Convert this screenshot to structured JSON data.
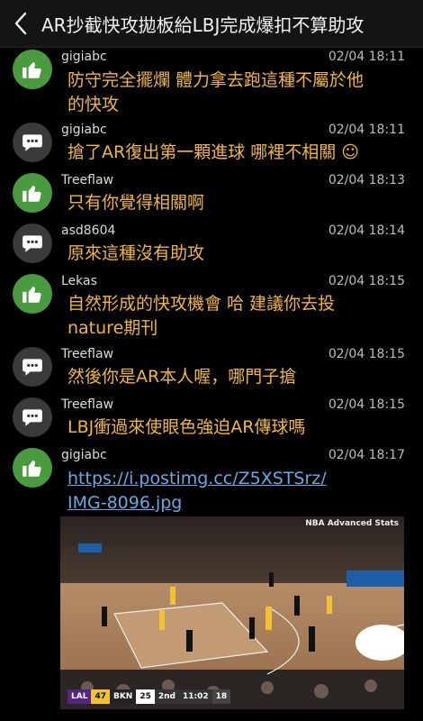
{
  "header": {
    "title": "AR抄截快攻拋板給LBJ完成爆扣不算助攻"
  },
  "posts": [
    {
      "type": "push",
      "user": "gigiabc",
      "time": "02/04 18:11",
      "text": "防守完全擺爛 體力拿去跑這種不屬於他\n的快攻"
    },
    {
      "type": "reply",
      "user": "gigiabc",
      "time": "02/04 18:11",
      "text": "搶了AR復出第一顆進球 哪裡不相關 ☺"
    },
    {
      "type": "push",
      "user": "Treeflaw",
      "time": "02/04 18:13",
      "text": "只有你覺得相關啊"
    },
    {
      "type": "reply",
      "user": "asd8604",
      "time": "02/04 18:14",
      "text": "原來這種沒有助攻"
    },
    {
      "type": "push",
      "user": "Lekas",
      "time": "02/04 18:15",
      "text": "自然形成的快攻機會 哈 建議你去投\nnature期刊"
    },
    {
      "type": "reply",
      "user": "Treeflaw",
      "time": "02/04 18:15",
      "text": "然後你是AR本人喔，哪門子搶"
    },
    {
      "type": "reply",
      "user": "Treeflaw",
      "time": "02/04 18:15",
      "text": "LBJ衝過來使眼色強迫AR傳球嗎"
    },
    {
      "type": "push",
      "user": "gigiabc",
      "time": "02/04 18:17",
      "link": "https://i.postimg.cc/Z5XSTSrz/\nIMG-8096.jpg"
    }
  ],
  "video": {
    "watermark": "NBA Advanced Stats",
    "team1": "LAL",
    "score1": "47",
    "team2": "BKN",
    "score2": "25",
    "period": "2nd",
    "clock": "11:02",
    "shot": "18"
  },
  "colors": {
    "push": "#4a9a3f",
    "reply": "#3a3a3a",
    "text": "#f0b545",
    "link": "#6aa9e6"
  }
}
